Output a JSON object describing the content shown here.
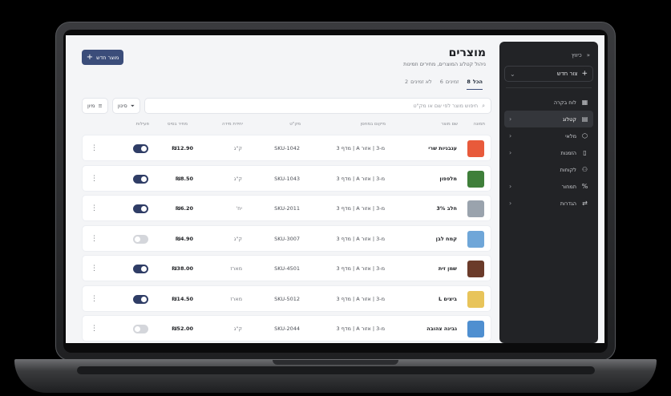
{
  "sidebar": {
    "collapse_label": "כיווץ",
    "new_label": "צור חדש",
    "items": [
      {
        "label": "לוח בקרה",
        "icon": "grid-icon",
        "chevron": false
      },
      {
        "label": "קטלוג",
        "icon": "catalog-icon",
        "chevron": true,
        "active": true
      },
      {
        "label": "מלאי",
        "icon": "box-icon",
        "chevron": true
      },
      {
        "label": "הזמנות",
        "icon": "receipt-icon",
        "chevron": true
      },
      {
        "label": "לקוחות",
        "icon": "users-icon",
        "chevron": false
      },
      {
        "label": "תמחור",
        "icon": "percent-icon",
        "chevron": true
      },
      {
        "label": "הגדרות",
        "icon": "sliders-icon",
        "chevron": true
      }
    ]
  },
  "header": {
    "title": "מוצרים",
    "subtitle": "ניהול קטלוג המוצרים, מחירים וזמינות",
    "add_label": "מוצר חדש"
  },
  "tabs": [
    {
      "label": "הכל",
      "count": "8",
      "active": true
    },
    {
      "label": "זמינים",
      "count": "6"
    },
    {
      "label": "לא זמינים",
      "count": "2"
    }
  ],
  "toolbar": {
    "search_placeholder": "חיפוש מוצר לפי שם או מק\"ט",
    "filter_label": "סינון",
    "sort_label": "מיון"
  },
  "table": {
    "columns": [
      "תמונה",
      "שם מוצר",
      "מיקום במחסן",
      "מק\"ט",
      "יחידת מידה",
      "מחיר בסיס",
      "פעילות"
    ],
    "rows": [
      {
        "name": "עגבניות שרי",
        "location": "מ-3 | אזור A | מדף 3",
        "sku": "SKU-1042",
        "unit": "ק\"ג",
        "price": "₪12.90",
        "active": true,
        "thumb": "#e85a3b"
      },
      {
        "name": "מלפפון",
        "location": "מ-3 | אזור A | מדף 3",
        "sku": "SKU-1043",
        "unit": "ק\"ג",
        "price": "₪8.50",
        "active": true,
        "thumb": "#3f7f3a"
      },
      {
        "name": "חלב 3%",
        "location": "מ-3 | אזור A | מדף 3",
        "sku": "SKU-2011",
        "unit": "יח'",
        "price": "₪6.20",
        "active": true,
        "thumb": "#9aa3ad"
      },
      {
        "name": "קמח לבן",
        "location": "מ-3 | אזור A | מדף 3",
        "sku": "SKU-3007",
        "unit": "ק\"ג",
        "price": "₪4.90",
        "active": false,
        "thumb": "#6fa6d8"
      },
      {
        "name": "שמן זית",
        "location": "מ-3 | אזור A | מדף 3",
        "sku": "SKU-4501",
        "unit": "מארז",
        "price": "₪38.00",
        "active": true,
        "thumb": "#6b3b2a"
      },
      {
        "name": "ביצים L",
        "location": "מ-3 | אזור A | מדף 3",
        "sku": "SKU-5012",
        "unit": "מארז",
        "price": "₪14.50",
        "active": true,
        "thumb": "#e8c45a"
      },
      {
        "name": "גבינה צהובה",
        "location": "מ-3 | אזור A | מדף 3",
        "sku": "SKU-2044",
        "unit": "ק\"ג",
        "price": "₪52.00",
        "active": false,
        "thumb": "#4f8fd0"
      }
    ]
  }
}
